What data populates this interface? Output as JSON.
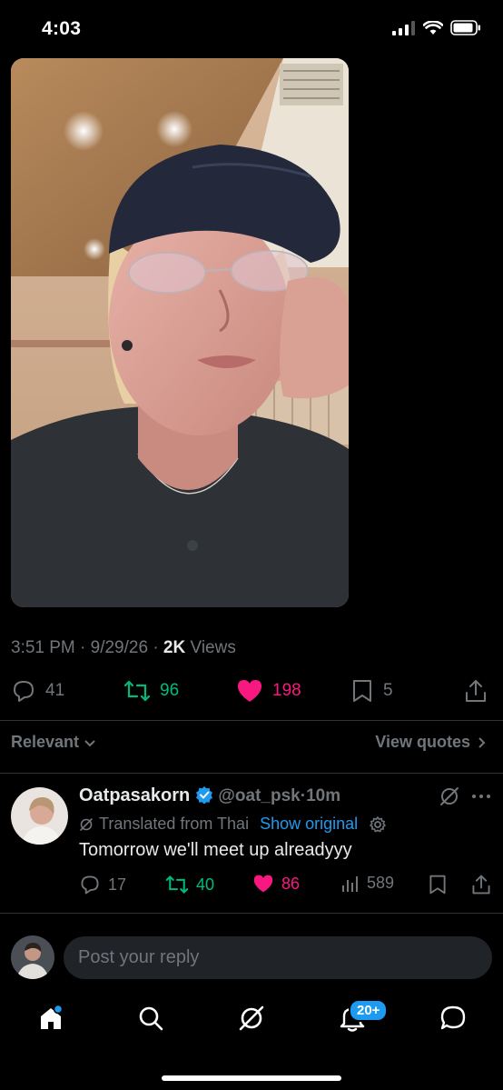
{
  "status_bar": {
    "time": "4:03"
  },
  "post": {
    "timestamp": "3:51 PM · 9/29/26 · ",
    "views_count": "2K",
    "views_label": " Views",
    "stats": {
      "replies": "41",
      "reposts": "96",
      "likes": "198",
      "bookmarks": "5"
    }
  },
  "replies_header": {
    "sort_label": "Relevant",
    "view_quotes_label": "View quotes"
  },
  "reply": {
    "author_name": "Oatpasakorn",
    "author_handle": "@oat_psk",
    "time_ago": "10m",
    "translated_label": "Translated from Thai",
    "show_original_label": "Show original",
    "text": "Tomorrow we'll meet up alreadyyy",
    "stats": {
      "replies": "17",
      "reposts": "40",
      "likes": "86",
      "views": "589"
    }
  },
  "composer": {
    "placeholder": "Post your reply"
  },
  "tab_bar": {
    "notifications_badge": "20+"
  },
  "colors": {
    "background": "#000000",
    "muted": "#71767b",
    "like": "#f91880",
    "repost": "#00ba7c",
    "link": "#1d9bf0",
    "verified": "#1d9bf0"
  }
}
